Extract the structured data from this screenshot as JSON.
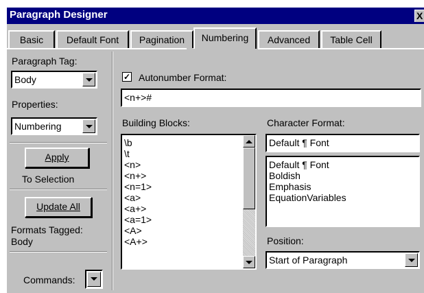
{
  "window": {
    "title": "Paragraph Designer",
    "close_glyph": "X"
  },
  "tabs": [
    "Basic",
    "Default Font",
    "Pagination",
    "Numbering",
    "Advanced",
    "Table Cell"
  ],
  "active_tab": "Numbering",
  "left": {
    "paragraph_tag_label": "Paragraph Tag:",
    "paragraph_tag_value": "Body",
    "properties_label": "Properties:",
    "properties_value": "Numbering",
    "apply_label": "Apply",
    "apply_sub": "To Selection",
    "update_all_label": "Update All",
    "formats_tagged_label": "Formats Tagged:",
    "formats_tagged_value": "Body",
    "commands_label": "Commands:"
  },
  "main": {
    "autonumber_checked": true,
    "autonumber_label": "Autonumber Format:",
    "autonumber_value": "<n+>#",
    "building_blocks_label": "Building Blocks:",
    "building_blocks": [
      "\\b",
      "\\t",
      "<n>",
      "<n+>",
      "<n=1>",
      "<a>",
      "<a+>",
      "<a=1>",
      "<A>",
      "<A+>"
    ],
    "character_format_label": "Character Format:",
    "character_format_value": "Default ¶ Font",
    "character_formats": [
      "Default ¶ Font",
      "Boldish",
      "Emphasis",
      "EquationVariables"
    ],
    "position_label": "Position:",
    "position_value": "Start of Paragraph"
  }
}
